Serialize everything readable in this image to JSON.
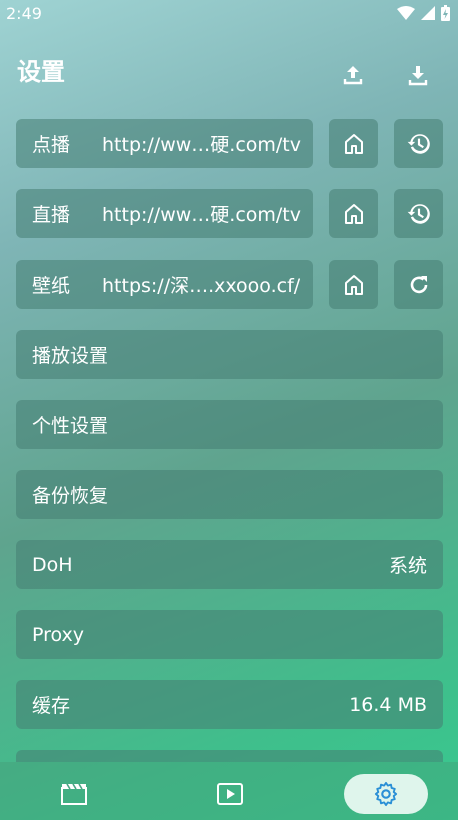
{
  "status": {
    "time": "2:49",
    "icons": [
      "wifi-icon",
      "signal-icon",
      "battery-icon"
    ]
  },
  "header": {
    "title": "设置",
    "actions": [
      "upload-icon",
      "download-icon"
    ]
  },
  "sources": [
    {
      "label": "点播",
      "value": "http://ww…硬.com/tv",
      "home_icon": "home-icon",
      "action_icon": "history-icon"
    },
    {
      "label": "直播",
      "value": "http://ww…硬.com/tv",
      "home_icon": "home-icon",
      "action_icon": "history-icon"
    },
    {
      "label": "壁纸",
      "value": "https://深….xxooo.cf/",
      "home_icon": "home-icon",
      "action_icon": "refresh-icon"
    }
  ],
  "settings": [
    {
      "label": "播放设置",
      "value": ""
    },
    {
      "label": "个性设置",
      "value": ""
    },
    {
      "label": "备份恢复",
      "value": ""
    },
    {
      "label": "DoH",
      "value": "系统"
    },
    {
      "label": "Proxy",
      "value": ""
    },
    {
      "label": "缓存",
      "value": "16.4 MB"
    }
  ],
  "nav": {
    "items": [
      "clapperboard-icon",
      "play-icon",
      "gear-icon"
    ],
    "active": "gear-icon"
  },
  "colors": {
    "accent": "#2a8fd6",
    "panel": "#467d73",
    "active_pill": "#dff5ec"
  }
}
